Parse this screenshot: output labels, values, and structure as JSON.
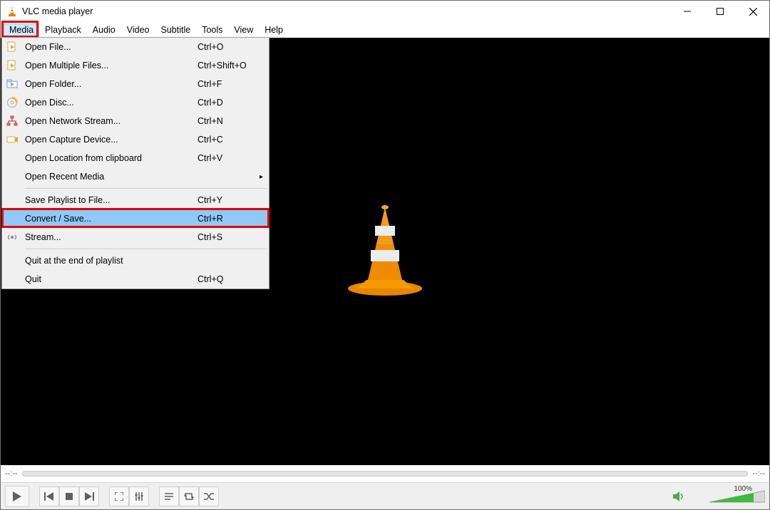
{
  "window": {
    "title": "VLC media player"
  },
  "menubar": [
    "Media",
    "Playback",
    "Audio",
    "Video",
    "Subtitle",
    "Tools",
    "View",
    "Help"
  ],
  "active_menu_index": 0,
  "media_menu": [
    {
      "kind": "item",
      "icon": "file-play-icon",
      "label": "Open File...",
      "accel": "Ctrl+O"
    },
    {
      "kind": "item",
      "icon": "file-play-icon",
      "label": "Open Multiple Files...",
      "accel": "Ctrl+Shift+O"
    },
    {
      "kind": "item",
      "icon": "folder-play-icon",
      "label": "Open Folder...",
      "accel": "Ctrl+F"
    },
    {
      "kind": "item",
      "icon": "disc-icon",
      "label": "Open Disc...",
      "accel": "Ctrl+D"
    },
    {
      "kind": "item",
      "icon": "network-icon",
      "label": "Open Network Stream...",
      "accel": "Ctrl+N"
    },
    {
      "kind": "item",
      "icon": "capture-icon",
      "label": "Open Capture Device...",
      "accel": "Ctrl+C"
    },
    {
      "kind": "item",
      "icon": "",
      "label": "Open Location from clipboard",
      "accel": "Ctrl+V"
    },
    {
      "kind": "item",
      "icon": "",
      "label": "Open Recent Media",
      "accel": "",
      "submenu": true
    },
    {
      "kind": "sep"
    },
    {
      "kind": "item",
      "icon": "",
      "label": "Save Playlist to File...",
      "accel": "Ctrl+Y"
    },
    {
      "kind": "item",
      "icon": "",
      "label": "Convert / Save...",
      "accel": "Ctrl+R",
      "selected": true,
      "highlight": true
    },
    {
      "kind": "item",
      "icon": "stream-icon",
      "label": "Stream...",
      "accel": "Ctrl+S"
    },
    {
      "kind": "sep"
    },
    {
      "kind": "item",
      "icon": "",
      "label": "Quit at the end of playlist",
      "accel": ""
    },
    {
      "kind": "item",
      "icon": "",
      "label": "Quit",
      "accel": "Ctrl+Q"
    }
  ],
  "seek": {
    "left_time": "--:--",
    "right_time": "--:--"
  },
  "volume": {
    "percent_label": "100%",
    "value": 100
  },
  "colors": {
    "highlight_red": "#e60000",
    "selection_blue": "#90c8f6"
  }
}
